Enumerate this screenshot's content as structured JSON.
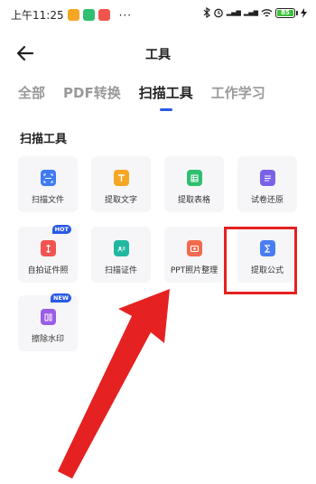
{
  "status": {
    "time": "上午11:25",
    "dots": "···",
    "battery": "85"
  },
  "header": {
    "title": "工具"
  },
  "tabs": [
    {
      "label": "全部"
    },
    {
      "label": "PDF转换"
    },
    {
      "label": "扫描工具"
    },
    {
      "label": "工作学习"
    }
  ],
  "section": {
    "title": "扫描工具"
  },
  "tools": [
    {
      "label": "扫描文件",
      "icon": "scan-file-icon",
      "color": "#3f7bf5"
    },
    {
      "label": "提取文字",
      "icon": "extract-text-icon",
      "color": "#f5a623"
    },
    {
      "label": "提取表格",
      "icon": "extract-table-icon",
      "color": "#2fbf71"
    },
    {
      "label": "试卷还原",
      "icon": "exam-restore-icon",
      "color": "#7b61e8"
    },
    {
      "label": "自拍证件照",
      "icon": "id-photo-icon",
      "color": "#f0544f",
      "badge": "HOT"
    },
    {
      "label": "扫描证件",
      "icon": "scan-id-icon",
      "color": "#22b8a0"
    },
    {
      "label": "PPT照片整理",
      "icon": "ppt-photo-icon",
      "color": "#f26b4f"
    },
    {
      "label": "提取公式",
      "icon": "extract-formula-icon",
      "color": "#4a7ef0"
    },
    {
      "label": "擦除水印",
      "icon": "remove-watermark-icon",
      "color": "#9b5de5",
      "badge": "NEW"
    }
  ],
  "colors": {
    "accent": "#2b59e6",
    "highlight": "#e52121",
    "annotation_arrow": "#e52121"
  }
}
